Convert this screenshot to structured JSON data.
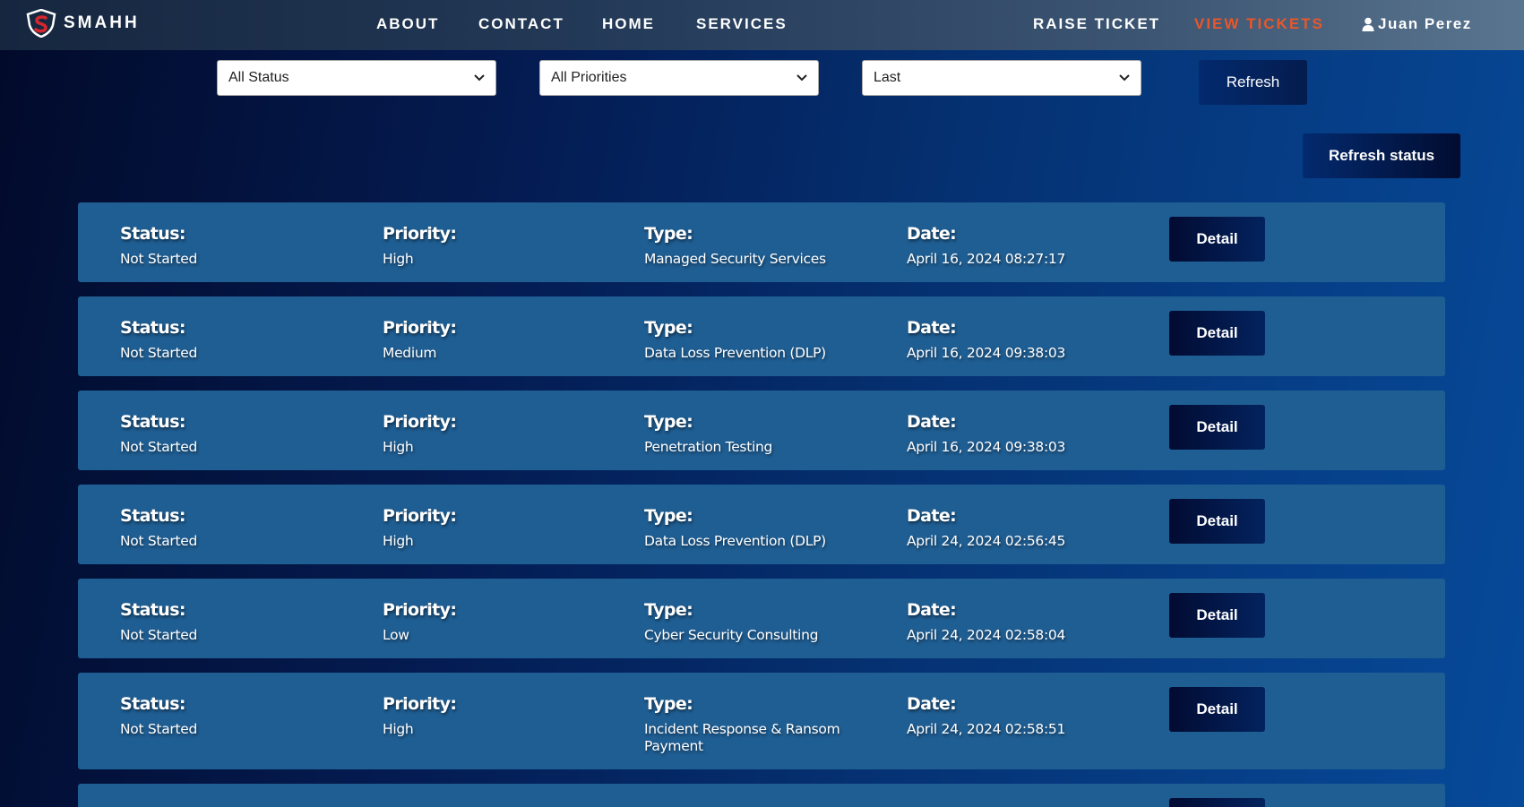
{
  "header": {
    "brand": "SMAHH",
    "nav": [
      "ABOUT",
      "CONTACT",
      "HOME",
      "SERVICES"
    ],
    "raise_ticket": "RAISE TICKET",
    "view_tickets": "VIEW TICKETS",
    "user_name": "Juan Perez",
    "active_color": "#e8572a"
  },
  "filters": {
    "status": "All Status",
    "priority": "All Priorities",
    "order": "Last",
    "refresh_label": "Refresh"
  },
  "refresh_status_label": "Refresh status",
  "labels": {
    "status": "Status:",
    "priority": "Priority:",
    "type": "Type:",
    "date": "Date:",
    "detail": "Detail"
  },
  "tickets": [
    {
      "status": "Not Started",
      "priority": "High",
      "type": "Managed Security Services",
      "date": "April 16, 2024 08:27:17"
    },
    {
      "status": "Not Started",
      "priority": "Medium",
      "type": "Data Loss Prevention (DLP)",
      "date": "April 16, 2024 09:38:03"
    },
    {
      "status": "Not Started",
      "priority": "High",
      "type": "Penetration Testing",
      "date": "April 16, 2024 09:38:03"
    },
    {
      "status": "Not Started",
      "priority": "High",
      "type": "Data Loss Prevention (DLP)",
      "date": "April 24, 2024 02:56:45"
    },
    {
      "status": "Not Started",
      "priority": "Low",
      "type": "Cyber Security Consulting",
      "date": "April 24, 2024 02:58:04"
    },
    {
      "status": "Not Started",
      "priority": "High",
      "type": "Incident Response & Ransom Payment",
      "date": "April 24, 2024 02:58:51"
    }
  ]
}
